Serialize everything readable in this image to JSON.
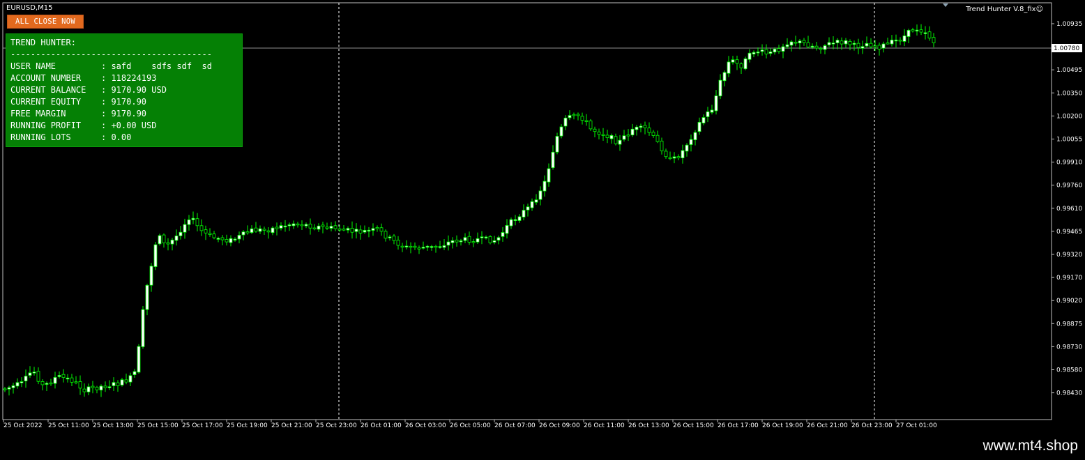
{
  "chart": {
    "symbol_label": "EURUSD,M15",
    "indicator_label": "Trend Hunter V.8_fix☺",
    "current_price": "1.00780",
    "y_ticks": [
      "1.00935",
      "1.00640",
      "1.00495",
      "1.00350",
      "1.00200",
      "1.00055",
      "0.99910",
      "0.99760",
      "0.99610",
      "0.99465",
      "0.99320",
      "0.99170",
      "0.99020",
      "0.98875",
      "0.98730",
      "0.98580",
      "0.98430"
    ],
    "x_ticks": [
      "25 Oct 2022",
      "25 Oct 11:00",
      "25 Oct 13:00",
      "25 Oct 15:00",
      "25 Oct 17:00",
      "25 Oct 19:00",
      "25 Oct 21:00",
      "25 Oct 23:00",
      "26 Oct 01:00",
      "26 Oct 03:00",
      "26 Oct 05:00",
      "26 Oct 07:00",
      "26 Oct 09:00",
      "26 Oct 11:00",
      "26 Oct 13:00",
      "26 Oct 15:00",
      "26 Oct 17:00",
      "26 Oct 19:00",
      "26 Oct 21:00",
      "26 Oct 23:00",
      "27 Oct 01:00"
    ],
    "colors": {
      "bull_body": "#ffffff",
      "bear_body": "#000000",
      "wick": "#00ff00",
      "grid": "#c0c0c0",
      "panel": "#058005",
      "button": "#e2691e"
    }
  },
  "button": {
    "label": "ALL CLOSE NOW"
  },
  "panel": {
    "title": "TREND HUNTER:",
    "separator": "----------------------------------------",
    "rows": [
      {
        "k": "USER NAME",
        "v": ": safd    sdfs sdf  sd"
      },
      {
        "k": "ACCOUNT NUMBER",
        "v": ": 118224193"
      },
      {
        "k": "CURRENT BALANCE",
        "v": ": 9170.90 USD"
      },
      {
        "k": "CURRENT EQUITY",
        "v": ": 9170.90"
      },
      {
        "k": "FREE MARGIN",
        "v": ": 9170.90"
      },
      {
        "k": "RUNNING PROFIT",
        "v": ": +0.00 USD"
      },
      {
        "k": "RUNNING LOTS",
        "v": ": 0.00"
      }
    ]
  },
  "footer": {
    "watermark": "www.mt4.shop"
  }
}
